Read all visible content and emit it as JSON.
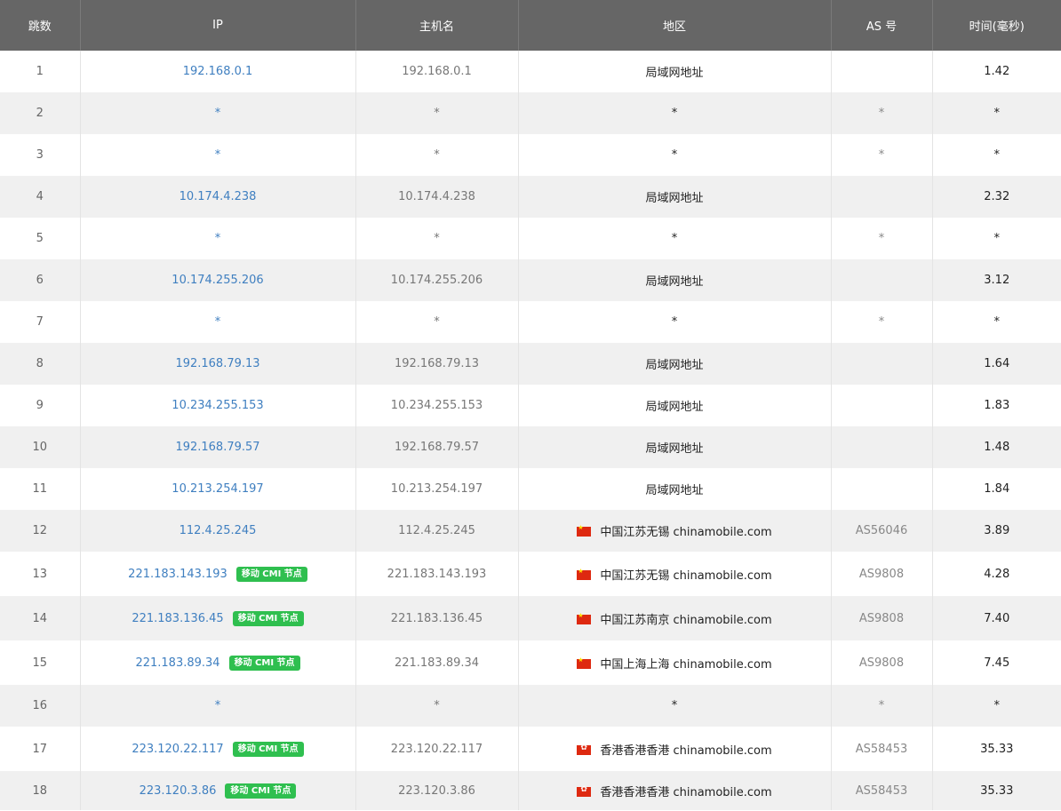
{
  "headers": {
    "hop": "跳数",
    "ip": "IP",
    "host": "主机名",
    "region": "地区",
    "as": "AS 号",
    "time": "时间(毫秒)"
  },
  "rows": [
    {
      "hop": "1",
      "ip": "192.168.0.1",
      "badge": "",
      "host": "192.168.0.1",
      "flag": "",
      "region": "局域网地址",
      "as": "",
      "time": "1.42"
    },
    {
      "hop": "2",
      "ip": "*",
      "badge": "",
      "host": "*",
      "flag": "",
      "region": "*",
      "as": "*",
      "time": "*"
    },
    {
      "hop": "3",
      "ip": "*",
      "badge": "",
      "host": "*",
      "flag": "",
      "region": "*",
      "as": "*",
      "time": "*"
    },
    {
      "hop": "4",
      "ip": "10.174.4.238",
      "badge": "",
      "host": "10.174.4.238",
      "flag": "",
      "region": "局域网地址",
      "as": "",
      "time": "2.32"
    },
    {
      "hop": "5",
      "ip": "*",
      "badge": "",
      "host": "*",
      "flag": "",
      "region": "*",
      "as": "*",
      "time": "*"
    },
    {
      "hop": "6",
      "ip": "10.174.255.206",
      "badge": "",
      "host": "10.174.255.206",
      "flag": "",
      "region": "局域网地址",
      "as": "",
      "time": "3.12"
    },
    {
      "hop": "7",
      "ip": "*",
      "badge": "",
      "host": "*",
      "flag": "",
      "region": "*",
      "as": "*",
      "time": "*"
    },
    {
      "hop": "8",
      "ip": "192.168.79.13",
      "badge": "",
      "host": "192.168.79.13",
      "flag": "",
      "region": "局域网地址",
      "as": "",
      "time": "1.64"
    },
    {
      "hop": "9",
      "ip": "10.234.255.153",
      "badge": "",
      "host": "10.234.255.153",
      "flag": "",
      "region": "局域网地址",
      "as": "",
      "time": "1.83"
    },
    {
      "hop": "10",
      "ip": "192.168.79.57",
      "badge": "",
      "host": "192.168.79.57",
      "flag": "",
      "region": "局域网地址",
      "as": "",
      "time": "1.48"
    },
    {
      "hop": "11",
      "ip": "10.213.254.197",
      "badge": "",
      "host": "10.213.254.197",
      "flag": "",
      "region": "局域网地址",
      "as": "",
      "time": "1.84"
    },
    {
      "hop": "12",
      "ip": "112.4.25.245",
      "badge": "",
      "host": "112.4.25.245",
      "flag": "cn-flag-icon",
      "region": "中国江苏无锡 chinamobile.com",
      "as": "AS56046",
      "time": "3.89"
    },
    {
      "hop": "13",
      "ip": "221.183.143.193",
      "badge": "移动 CMI 节点",
      "host": "221.183.143.193",
      "flag": "cn-flag-icon",
      "region": "中国江苏无锡 chinamobile.com",
      "as": "AS9808",
      "time": "4.28"
    },
    {
      "hop": "14",
      "ip": "221.183.136.45",
      "badge": "移动 CMI 节点",
      "host": "221.183.136.45",
      "flag": "cn-flag-icon",
      "region": "中国江苏南京 chinamobile.com",
      "as": "AS9808",
      "time": "7.40"
    },
    {
      "hop": "15",
      "ip": "221.183.89.34",
      "badge": "移动 CMI 节点",
      "host": "221.183.89.34",
      "flag": "cn-flag-icon",
      "region": "中国上海上海 chinamobile.com",
      "as": "AS9808",
      "time": "7.45"
    },
    {
      "hop": "16",
      "ip": "*",
      "badge": "",
      "host": "*",
      "flag": "",
      "region": "*",
      "as": "*",
      "time": "*"
    },
    {
      "hop": "17",
      "ip": "223.120.22.117",
      "badge": "移动 CMI 节点",
      "host": "223.120.22.117",
      "flag": "hk-flag-icon",
      "region": "香港香港香港 chinamobile.com",
      "as": "AS58453",
      "time": "35.33"
    },
    {
      "hop": "18",
      "ip": "223.120.3.86",
      "badge": "移动 CMI 节点",
      "host": "223.120.3.86",
      "flag": "hk-flag-icon",
      "region": "香港香港香港 chinamobile.com",
      "as": "AS58453",
      "time": "35.33"
    }
  ]
}
